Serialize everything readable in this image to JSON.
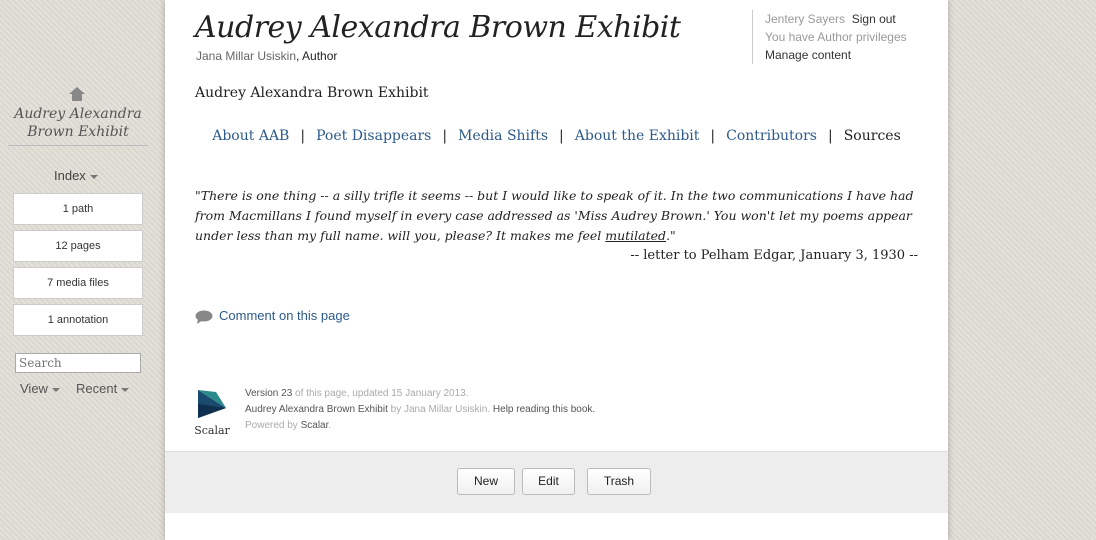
{
  "sidebar": {
    "book_title": "Audrey Alexandra Brown Exhibit",
    "index_label": "Index",
    "boxes": [
      "1 path",
      "12 pages",
      "7 media files",
      "1 annotation"
    ],
    "search_placeholder": "Search",
    "view_label": "View",
    "recent_label": "Recent"
  },
  "header": {
    "title": "Audrey Alexandra Brown Exhibit",
    "author_name": "Jana Millar Usiskin",
    "author_role": ", Author",
    "user_name": "Jentery Sayers",
    "sign_out": "Sign out",
    "privileges": "You have Author privileges",
    "manage": "Manage content"
  },
  "page": {
    "subtitle": "Audrey Alexandra Brown Exhibit",
    "nav": [
      {
        "label": "About AAB"
      },
      {
        "label": "Poet Disappears"
      },
      {
        "label": "Media Shifts"
      },
      {
        "label": "About the Exhibit"
      },
      {
        "label": "Contributors"
      },
      {
        "label": "Sources"
      }
    ],
    "nav_sep": "|",
    "quote_before": "\"There is one thing -- a silly trifle it seems -- but I would like to speak of it. In the two communications I have had from Macmillans I found myself in every case addressed as 'Miss Audrey Brown.' You won't let my poems appear under less than my full name. will you, please? It makes me feel ",
    "quote_underlined": "mutilated",
    "quote_after": ".\"",
    "attribution": "-- letter to Pelham Edgar, January 3, 1930 --",
    "comment_link": "Comment on this page"
  },
  "footer": {
    "logo_text": "Scalar",
    "version": "Version 23",
    "version_rest": " of this page, updated 15 January 2013.",
    "book_name": "Audrey Alexandra Brown Exhibit",
    "by": " by ",
    "author": "Jana Millar Usiskin",
    "help": "Help reading this book",
    "powered": "Powered by ",
    "scalar": "Scalar"
  },
  "actions": {
    "new": "New",
    "edit": "Edit",
    "trash": "Trash"
  },
  "colors": {
    "link": "#2d5a8a",
    "background": "#dedbd3"
  }
}
